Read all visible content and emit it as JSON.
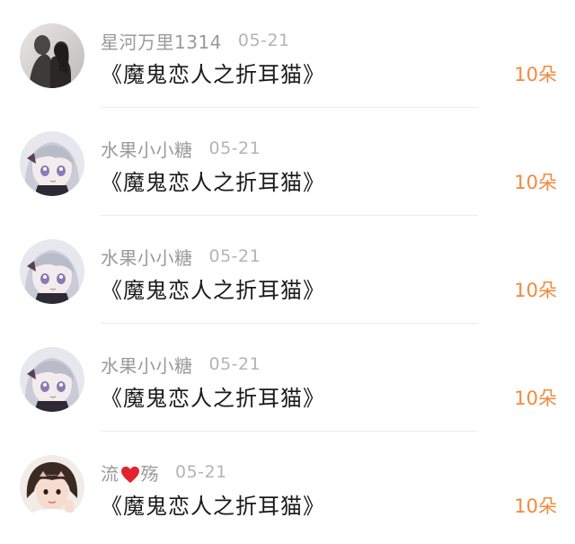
{
  "entries": [
    {
      "user_name_parts": [
        "星河万里1314"
      ],
      "has_heart": false,
      "date": "05-21",
      "gift_title": "《魔鬼恋人之折耳猫》",
      "count": "10朵",
      "avatar": "couple-silhouette-avatar"
    },
    {
      "user_name_parts": [
        "水果小小糖"
      ],
      "has_heart": false,
      "date": "05-21",
      "gift_title": "《魔鬼恋人之折耳猫》",
      "count": "10朵",
      "avatar": "anime-girl-avatar"
    },
    {
      "user_name_parts": [
        "水果小小糖"
      ],
      "has_heart": false,
      "date": "05-21",
      "gift_title": "《魔鬼恋人之折耳猫》",
      "count": "10朵",
      "avatar": "anime-girl-avatar"
    },
    {
      "user_name_parts": [
        "水果小小糖"
      ],
      "has_heart": false,
      "date": "05-21",
      "gift_title": "《魔鬼恋人之折耳猫》",
      "count": "10朵",
      "avatar": "anime-girl-avatar"
    },
    {
      "user_name_parts": [
        "流",
        "殇"
      ],
      "has_heart": true,
      "date": "05-21",
      "gift_title": "《魔鬼恋人之折耳猫》",
      "count": "10朵",
      "avatar": "girl-photo-avatar"
    }
  ],
  "colors": {
    "name": "#9a9a9a",
    "date": "#b4b4b4",
    "title": "#1a1a1a",
    "count": "#f08a3c",
    "heart": "#e0242e"
  }
}
